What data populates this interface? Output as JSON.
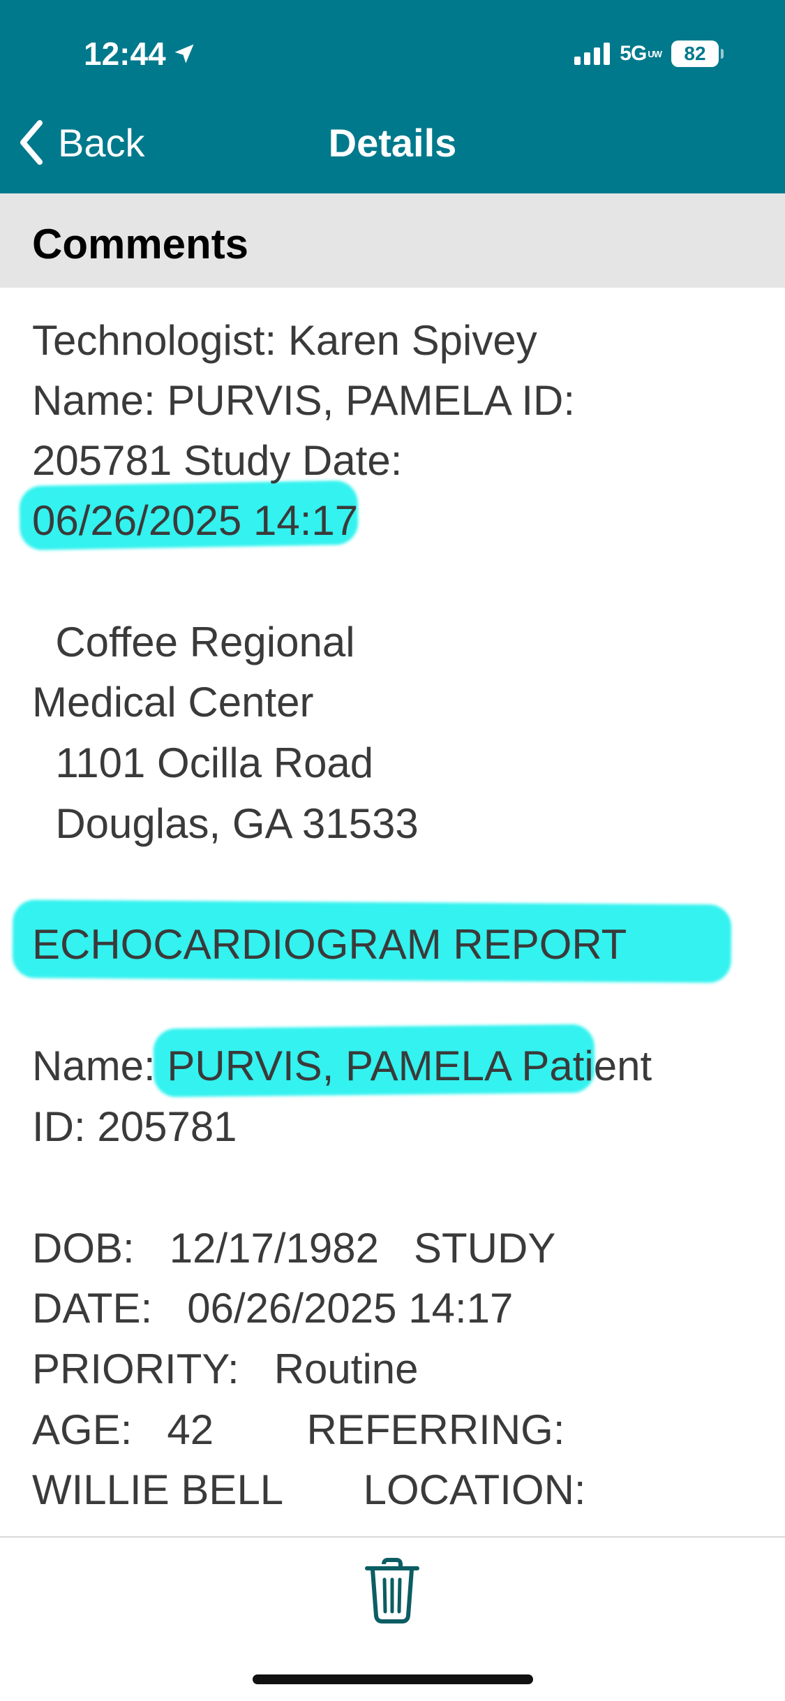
{
  "status_bar": {
    "time": "12:44",
    "network": "5G",
    "network_badge": "UW",
    "battery": "82"
  },
  "nav": {
    "back_label": "Back",
    "title": "Details"
  },
  "section": {
    "title": "Comments"
  },
  "comment_lines": [
    "Technologist: Karen Spivey",
    "Name: PURVIS, PAMELA ID:",
    "205781 Study Date:",
    "06/26/2025 14:17",
    "",
    "  Coffee Regional",
    "Medical Center",
    "  1101 Ocilla Road",
    "  Douglas, GA 31533",
    "",
    "ECHOCARDIOGRAM REPORT",
    "",
    "Name: PURVIS, PAMELA Patient",
    "ID: 205781",
    "",
    "DOB:   12/17/1982   STUDY",
    "DATE:   06/26/2025 14:17",
    "PRIORITY:   Routine",
    "AGE:   42        REFERRING:",
    "WILLIE BELL       LOCATION:"
  ],
  "colors": {
    "nav_bar": "#00798c",
    "section_header": "#e5e5e5",
    "highlight": "#33f2ef",
    "body_text": "#3a3a3a"
  },
  "toolbar": {
    "delete_icon": "trash-icon"
  }
}
